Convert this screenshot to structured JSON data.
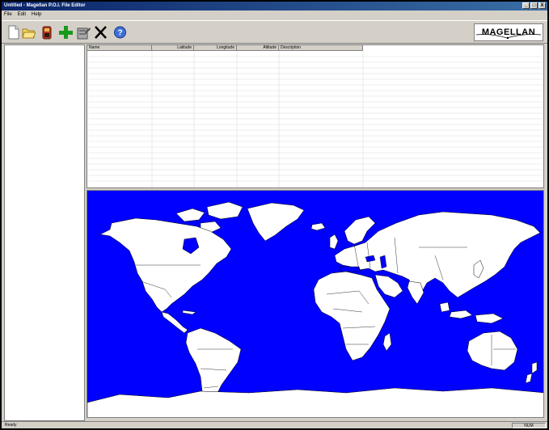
{
  "window": {
    "title": "Untitled - Magellan P.O.I. File Editor",
    "controls": [
      "_",
      "□",
      "X"
    ]
  },
  "menu": [
    "File",
    "Edit",
    "Help"
  ],
  "toolbar": {
    "buttons": [
      "new-file-icon",
      "open-folder-icon",
      "save-icon",
      "add-icon",
      "edit-icon",
      "delete-icon",
      "help-icon"
    ],
    "logo": "MAGELLAN"
  },
  "grid": {
    "columns": [
      "Name",
      "Latitude",
      "Longitude",
      "Altitude",
      "Description"
    ],
    "rows": []
  },
  "map": {
    "ocean_color": "#0000ff",
    "land_color": "#ffffff",
    "border_color": "#000000"
  },
  "status": {
    "left": "Ready",
    "right": "NUM"
  }
}
